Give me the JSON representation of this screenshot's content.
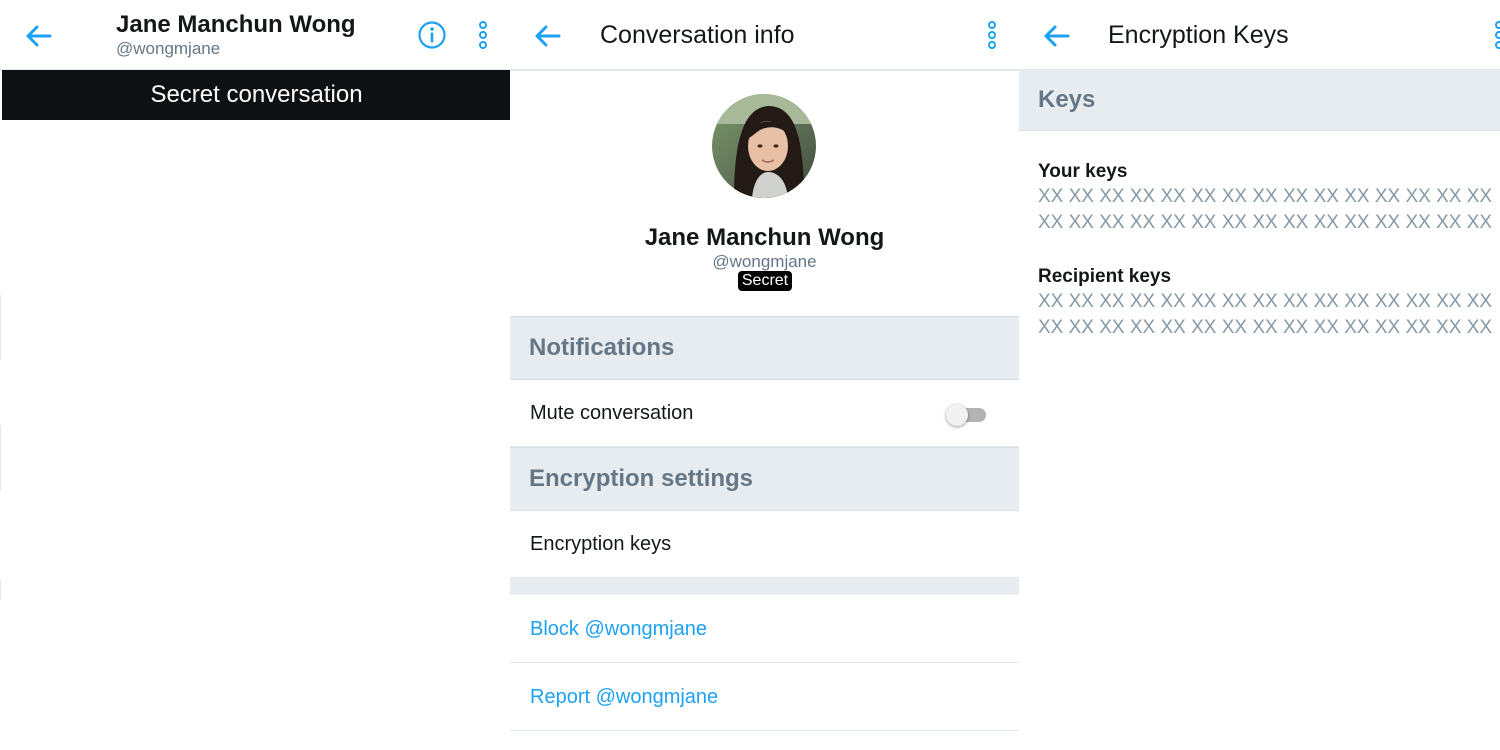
{
  "colors": {
    "accent": "#1da1f2",
    "banner_bg": "#0e1114",
    "section_bg": "#e6ecf0",
    "muted_text": "#657786"
  },
  "chat": {
    "header": {
      "name": "Jane Manchun Wong",
      "handle": "@wongmjane"
    },
    "icons": {
      "back": "arrow-left-icon",
      "info": "info-icon",
      "menu": "more-vertical-icon"
    },
    "banner": "Secret conversation"
  },
  "conversation_info": {
    "header": {
      "title": "Conversation info"
    },
    "profile": {
      "name": "Jane Manchun Wong",
      "handle": "@wongmjane",
      "badge": "Secret"
    },
    "notifications": {
      "heading": "Notifications",
      "mute_label": "Mute conversation",
      "mute_on": false
    },
    "encryption": {
      "heading": "Encryption settings",
      "keys_label": "Encryption keys"
    },
    "actions": {
      "block": "Block @wongmjane",
      "report": "Report @wongmjane"
    }
  },
  "encryption_keys": {
    "header": {
      "title": "Encryption Keys"
    },
    "section_heading": "Keys",
    "your_keys": {
      "label": "Your keys",
      "lines": [
        "XX XX XX XX XX XX XX XX XX XX XX XX XX XX XX",
        "XX XX XX XX XX XX XX XX XX XX XX XX XX XX XX"
      ]
    },
    "recipient_keys": {
      "label": "Recipient keys",
      "lines": [
        "XX XX XX XX XX XX XX XX XX XX XX XX XX XX XX",
        "XX XX XX XX XX XX XX XX XX XX XX XX XX XX XX"
      ]
    }
  }
}
